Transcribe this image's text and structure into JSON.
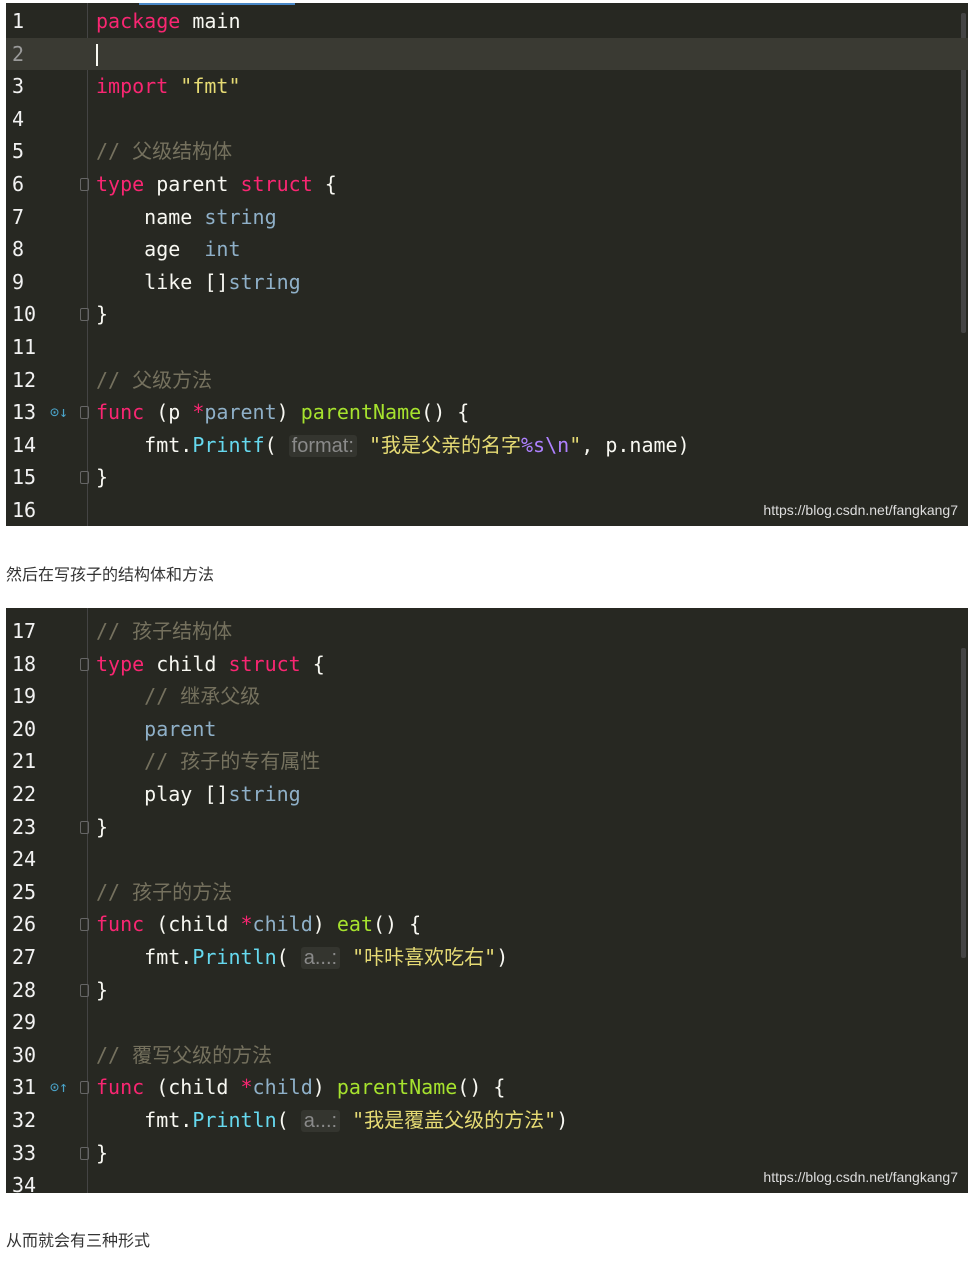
{
  "block1": {
    "watermark": "https://blog.csdn.net/fangkang7",
    "lines": [
      {
        "n": "1",
        "tokens": [
          [
            "k",
            "package"
          ],
          [
            "p",
            " main"
          ]
        ]
      },
      {
        "n": "2",
        "current": true,
        "tokens": []
      },
      {
        "n": "3",
        "tokens": [
          [
            "k",
            "import"
          ],
          [
            "p",
            " "
          ],
          [
            "s",
            "\"fmt\""
          ]
        ]
      },
      {
        "n": "4",
        "tokens": []
      },
      {
        "n": "5",
        "tokens": [
          [
            "c",
            "// 父级结构体"
          ]
        ]
      },
      {
        "n": "6",
        "fold": true,
        "tokens": [
          [
            "k",
            "type"
          ],
          [
            "p",
            " parent "
          ],
          [
            "k",
            "struct"
          ],
          [
            "p",
            " {"
          ]
        ]
      },
      {
        "n": "7",
        "tokens": [
          [
            "p",
            "    name "
          ],
          [
            "t",
            "string"
          ]
        ]
      },
      {
        "n": "8",
        "tokens": [
          [
            "p",
            "    age  "
          ],
          [
            "t",
            "int"
          ]
        ]
      },
      {
        "n": "9",
        "tokens": [
          [
            "p",
            "    like []"
          ],
          [
            "t",
            "string"
          ]
        ]
      },
      {
        "n": "10",
        "fold": true,
        "tokens": [
          [
            "p",
            "}"
          ]
        ]
      },
      {
        "n": "11",
        "tokens": []
      },
      {
        "n": "12",
        "tokens": [
          [
            "c",
            "// 父级方法"
          ]
        ]
      },
      {
        "n": "13",
        "fold": true,
        "mark": "implemented-down-icon",
        "tokens": [
          [
            "k",
            "func"
          ],
          [
            "p",
            " (p "
          ],
          [
            "k",
            "*"
          ],
          [
            "t",
            "parent"
          ],
          [
            "p",
            ") "
          ],
          [
            "f",
            "parentName"
          ],
          [
            "p",
            "() {"
          ]
        ]
      },
      {
        "n": "14",
        "tokens": [
          [
            "p",
            "    fmt."
          ],
          [
            "m",
            "Printf"
          ],
          [
            "p",
            "( "
          ],
          [
            "h",
            "format:"
          ],
          [
            "p",
            " "
          ],
          [
            "s",
            "\"我是父亲的名字"
          ],
          [
            "e",
            "%s\\n"
          ],
          [
            "s",
            "\""
          ],
          [
            "p",
            ", p.name)"
          ]
        ]
      },
      {
        "n": "15",
        "fold": true,
        "tokens": [
          [
            "p",
            "}"
          ]
        ]
      },
      {
        "n": "16",
        "tokens": []
      }
    ]
  },
  "paragraph1": "然后在写孩子的结构体和方法",
  "block2": {
    "watermark": "https://blog.csdn.net/fangkang7",
    "lines": [
      {
        "n": "17",
        "tokens": [
          [
            "c",
            "// 孩子结构体"
          ]
        ]
      },
      {
        "n": "18",
        "fold": true,
        "tokens": [
          [
            "k",
            "type"
          ],
          [
            "p",
            " child "
          ],
          [
            "k",
            "struct"
          ],
          [
            "p",
            " {"
          ]
        ]
      },
      {
        "n": "19",
        "tokens": [
          [
            "c",
            "    // 继承父级"
          ]
        ]
      },
      {
        "n": "20",
        "tokens": [
          [
            "t",
            "    parent"
          ]
        ]
      },
      {
        "n": "21",
        "tokens": [
          [
            "c",
            "    // 孩子的专有属性"
          ]
        ]
      },
      {
        "n": "22",
        "tokens": [
          [
            "p",
            "    play []"
          ],
          [
            "t",
            "string"
          ]
        ]
      },
      {
        "n": "23",
        "fold": true,
        "tokens": [
          [
            "p",
            "}"
          ]
        ]
      },
      {
        "n": "24",
        "tokens": []
      },
      {
        "n": "25",
        "tokens": [
          [
            "c",
            "// 孩子的方法"
          ]
        ]
      },
      {
        "n": "26",
        "fold": true,
        "tokens": [
          [
            "k",
            "func"
          ],
          [
            "p",
            " (child "
          ],
          [
            "k",
            "*"
          ],
          [
            "t",
            "child"
          ],
          [
            "p",
            ") "
          ],
          [
            "f",
            "eat"
          ],
          [
            "p",
            "() {"
          ]
        ]
      },
      {
        "n": "27",
        "tokens": [
          [
            "p",
            "    fmt."
          ],
          [
            "m",
            "Println"
          ],
          [
            "p",
            "( "
          ],
          [
            "h",
            "a...:"
          ],
          [
            "p",
            " "
          ],
          [
            "s",
            "\"咔咔喜欢吃右\""
          ],
          [
            "p",
            ")"
          ]
        ]
      },
      {
        "n": "28",
        "fold": true,
        "tokens": [
          [
            "p",
            "}"
          ]
        ]
      },
      {
        "n": "29",
        "tokens": []
      },
      {
        "n": "30",
        "tokens": [
          [
            "c",
            "// 覆写父级的方法"
          ]
        ]
      },
      {
        "n": "31",
        "fold": true,
        "mark": "overrides-up-icon",
        "tokens": [
          [
            "k",
            "func"
          ],
          [
            "p",
            " (child "
          ],
          [
            "k",
            "*"
          ],
          [
            "t",
            "child"
          ],
          [
            "p",
            ") "
          ],
          [
            "f",
            "parentName"
          ],
          [
            "p",
            "() {"
          ]
        ]
      },
      {
        "n": "32",
        "tokens": [
          [
            "p",
            "    fmt."
          ],
          [
            "m",
            "Println"
          ],
          [
            "p",
            "( "
          ],
          [
            "h",
            "a...:"
          ],
          [
            "p",
            " "
          ],
          [
            "s",
            "\"我是覆盖父级的方法\""
          ],
          [
            "p",
            ")"
          ]
        ]
      },
      {
        "n": "33",
        "fold": true,
        "tokens": [
          [
            "p",
            "}"
          ]
        ]
      },
      {
        "n": "34",
        "tokens": []
      }
    ]
  },
  "paragraph2": "从而就会有三种形式"
}
